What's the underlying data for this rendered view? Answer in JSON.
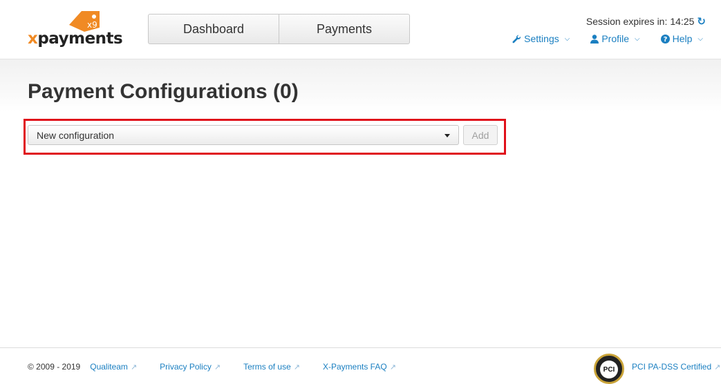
{
  "brand": {
    "logo_prefix": "x",
    "logo_name": "payments",
    "logo_tag": "x9"
  },
  "nav": {
    "items": [
      {
        "label": "Dashboard"
      },
      {
        "label": "Payments"
      }
    ]
  },
  "session": {
    "label": "Session expires in:",
    "time": "14:25",
    "refresh_icon": "refresh-icon"
  },
  "toolbar": {
    "items": [
      {
        "label": "Settings",
        "icon": "wrench-icon"
      },
      {
        "label": "Profile",
        "icon": "user-icon"
      },
      {
        "label": "Help",
        "icon": "question-circle-icon"
      }
    ]
  },
  "page": {
    "title": "Payment Configurations (0)"
  },
  "new_config": {
    "selected": "New configuration",
    "add_label": "Add",
    "highlight_color": "#e0101a"
  },
  "footer": {
    "copyright": "© 2009 - 2019",
    "links": [
      {
        "label": "Qualiteam"
      },
      {
        "label": "Privacy Policy"
      },
      {
        "label": "Terms of use"
      },
      {
        "label": "X-Payments FAQ"
      }
    ],
    "certification": "PCI PA-DSS Certified",
    "badge_text": "PCI"
  },
  "colors": {
    "accent": "#1a7fc1",
    "brand_orange": "#f08a24"
  }
}
